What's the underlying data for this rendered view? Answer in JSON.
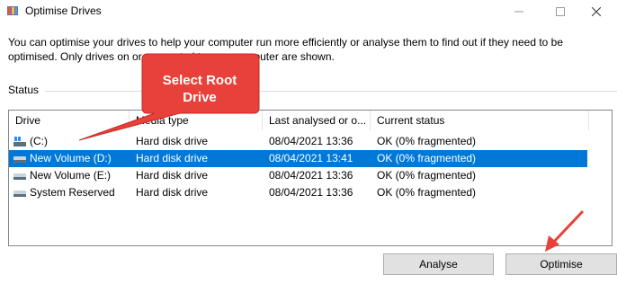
{
  "window": {
    "title": "Optimise Drives",
    "minimize_icon": "minimize-icon",
    "maximize_icon": "maximize-icon",
    "close_icon": "close-icon"
  },
  "intro_text": "You can optimise your drives to help your computer run more efficiently or analyse them to find out if they need to be optimised. Only drives on or connected to your computer are shown.",
  "status_label": "Status",
  "table": {
    "columns": [
      "Drive",
      "Media type",
      "Last analysed or o...",
      "Current status"
    ],
    "rows": [
      {
        "drive": "(C:)",
        "media": "Hard disk drive",
        "last": "08/04/2021 13:36",
        "status": "OK (0% fragmented)",
        "icon": "windows-drive-icon"
      },
      {
        "drive": "New Volume (D:)",
        "media": "Hard disk drive",
        "last": "08/04/2021 13:41",
        "status": "OK (0% fragmented)",
        "icon": "drive-icon"
      },
      {
        "drive": "New Volume (E:)",
        "media": "Hard disk drive",
        "last": "08/04/2021 13:36",
        "status": "OK (0% fragmented)",
        "icon": "drive-icon"
      },
      {
        "drive": "System Reserved",
        "media": "Hard disk drive",
        "last": "08/04/2021 13:36",
        "status": "OK (0% fragmented)",
        "icon": "drive-icon"
      }
    ],
    "selected_row": 1
  },
  "buttons": {
    "analyse": "Analyse",
    "optimise": "Optimise"
  },
  "callout": {
    "line1": "Select Root",
    "line2": "Drive"
  },
  "colors": {
    "selection": "#0078d7",
    "callout": "#e8413a"
  }
}
